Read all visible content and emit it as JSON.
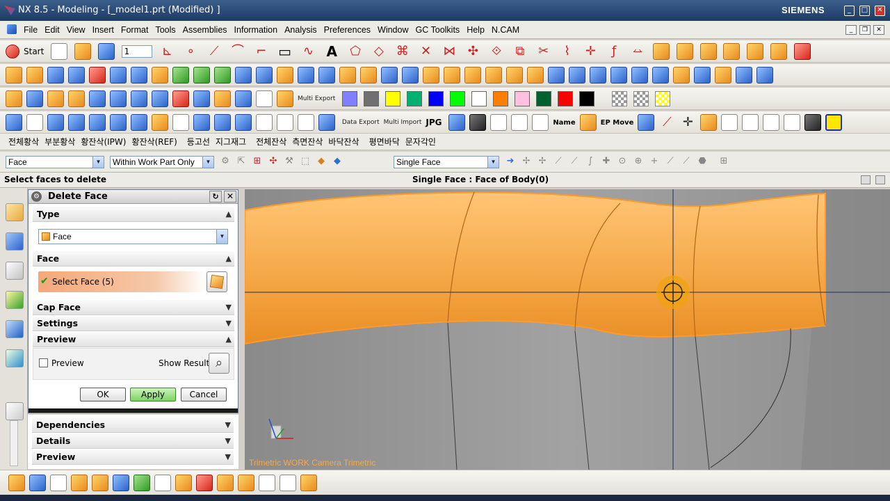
{
  "window": {
    "title": "NX 8.5 - Modeling - [_model1.prt (Modified) ]",
    "brand": "SIEMENS"
  },
  "menu": [
    "File",
    "Edit",
    "View",
    "Insert",
    "Format",
    "Tools",
    "Assemblies",
    "Information",
    "Analysis",
    "Preferences",
    "Window",
    "GC Toolkits",
    "Help",
    "N.CAM"
  ],
  "toolbar": {
    "start_label": "Start",
    "layer_value": "1",
    "texts": {
      "data_export": "Data Export",
      "multi_import": "Multi Import",
      "jpg": "JPG",
      "name": "Name",
      "ep_move": "EP Move",
      "multi_export": "Multi Export"
    }
  },
  "korean_toolbar": [
    "전체황삭",
    "부분황삭",
    "황잔삭(IPW)",
    "황잔삭(REF)",
    "등고선",
    "지그재그",
    "전체잔삭",
    "측면잔삭",
    "바닥잔삭",
    "평면바닥",
    "문자각인"
  ],
  "selection_bar": {
    "type_filter": "Face",
    "scope": "Within Work Part Only",
    "face_rule": "Single Face"
  },
  "cue_line": {
    "prompt": "Select faces to delete",
    "status": "Single Face : Face of Body(0)"
  },
  "dialog": {
    "title": "Delete Face",
    "type_group": "Type",
    "type_value": "Face",
    "face_group": "Face",
    "select_face": "Select Face (5)",
    "cap_face": "Cap Face",
    "settings": "Settings",
    "preview_group": "Preview",
    "preview_checkbox": "Preview",
    "show_result": "Show Result",
    "ok": "OK",
    "apply": "Apply",
    "cancel": "Cancel"
  },
  "lower_panel": {
    "dependencies": "Dependencies",
    "details": "Details",
    "preview": "Preview"
  },
  "viewport": {
    "view_label": "Trimetric WORK Camera Trimetric",
    "body_color": "#f5a847"
  },
  "colors": {
    "swatches": [
      "#8080ff",
      "#707070",
      "#ffff00",
      "#00b070",
      "#0000ff",
      "#00ff00",
      "#ffffff",
      "#ff8000",
      "#ffc0e0",
      "#006030",
      "#ff0000",
      "#000000"
    ]
  }
}
